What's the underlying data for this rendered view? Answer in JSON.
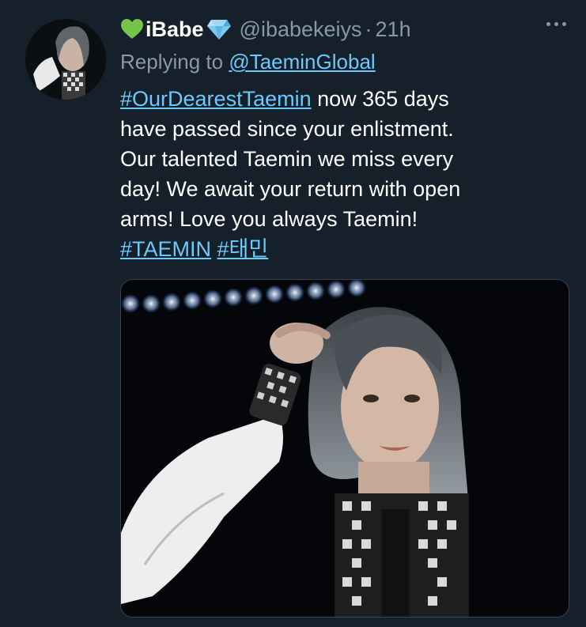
{
  "tweet": {
    "display_name": "iBabe",
    "handle": "@ibabekeiys",
    "separator": "·",
    "time": "21h",
    "replying_prefix": "Replying to",
    "replying_to": "@TaeminGlobal",
    "hashtag_main": "#OurDearestTaemin",
    "line1_rest": " now 365 days",
    "line2": "have passed since your enlistment.",
    "line3": "Our talented Taemin we miss every",
    "line4": "day! We await your return with open",
    "line5": "arms! Love you always Taemin!",
    "hashtag_taemin": "#TAEMIN",
    "hashtag_korean": "#태민"
  },
  "icons": {
    "before_name": "green-heart-icon",
    "after_name": "gem-icon",
    "menu": "more-icon"
  },
  "colors": {
    "background": "#15202b",
    "link": "#6bc9fb",
    "muted": "#8899a6"
  }
}
